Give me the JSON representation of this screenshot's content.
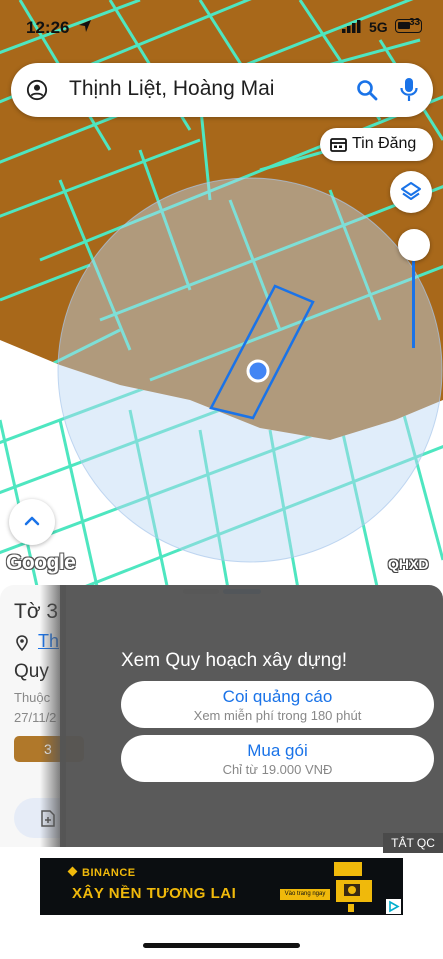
{
  "status_bar": {
    "time": "12:26",
    "network": "5G",
    "battery": "33"
  },
  "search": {
    "query": "Thịnh Liệt, Hoàng Mai"
  },
  "map": {
    "tin_dang_label": "Tin Đăng",
    "google_label": "Google",
    "layer_label": "QHXD",
    "parcel_color": "#a8681a",
    "boundary_color": "#4ee6c0",
    "highlight_color": "#1a73e8"
  },
  "bottom_sheet": {
    "title": "Tờ 3",
    "location_link": "Th",
    "subtitle": "Quy",
    "info_line1": "Thuộc",
    "info_line2": "27/11/2",
    "tag": "3"
  },
  "overlay": {
    "title": "Xem Quy hoạch xây dựng!",
    "watch_ad_label": "Coi quảng cáo",
    "watch_ad_sub": "Xem miễn phí trong 180 phút",
    "buy_label": "Mua gói",
    "buy_sub": "Chỉ từ 19.000 VNĐ",
    "hide_ads_label": "TẮT QC"
  },
  "ad": {
    "brand": "BINANCE",
    "tagline": "XÂY NỀN TƯƠNG LAI",
    "cta": "Vào trang ngay"
  }
}
